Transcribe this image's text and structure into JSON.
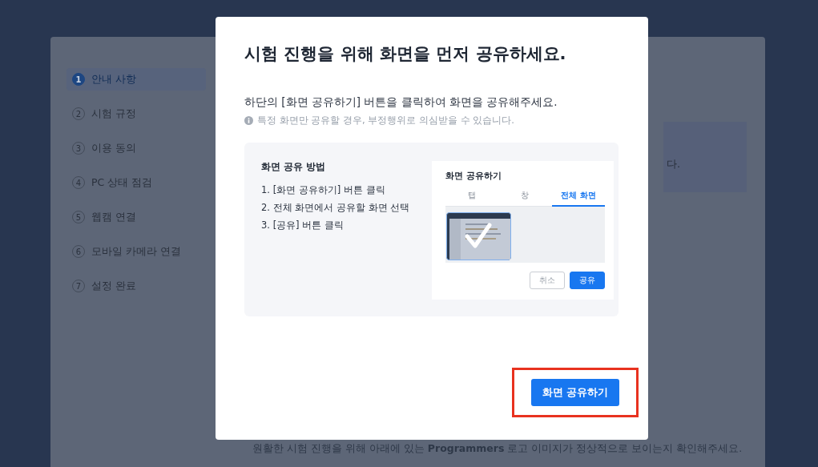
{
  "steps": [
    {
      "number": "1",
      "label": "안내 사항",
      "selected": true
    },
    {
      "number": "2",
      "label": "시험 규정",
      "selected": false
    },
    {
      "number": "3",
      "label": "이용 동의",
      "selected": false
    },
    {
      "number": "4",
      "label": "PC 상태 점검",
      "selected": false
    },
    {
      "number": "5",
      "label": "웹캠 연결",
      "selected": false
    },
    {
      "number": "6",
      "label": "모바일 카메라 연결",
      "selected": false
    },
    {
      "number": "7",
      "label": "설정 완료",
      "selected": false
    }
  ],
  "background_text": "다.",
  "bottom_note": "원활한 시험 진행을 위해 아래에 있는 **Programmers** 로고 이미지가 정상적으로 보이는지 확인해주세요.",
  "modal": {
    "title": "시험 진행을 위해 화면을 먼저 공유하세요.",
    "instruction": "하단의 [화면 공유하기] 버튼을 클릭하여 화면을 공유해주세요.",
    "notice": "특정 화면만 공유할 경우, 부정행위로 의심받을 수 있습니다.",
    "guide": {
      "heading": "화면 공유 방법",
      "steps": [
        "1. [화면 공유하기] 버튼 클릭",
        "2. 전체 화면에서 공유할 화면 선택",
        "3. [공유] 버튼 클릭"
      ],
      "example": {
        "title": "화면 공유하기",
        "tabs": [
          {
            "label": "탭",
            "selected": false
          },
          {
            "label": "창",
            "selected": false
          },
          {
            "label": "전체 화면",
            "selected": true
          }
        ],
        "thumbnail": {
          "selected": true
        },
        "buttons": [
          {
            "label": "취소",
            "kind": "secondary"
          },
          {
            "label": "공유",
            "kind": "primary"
          }
        ]
      }
    },
    "share_button": {
      "label": "화면 공유하기",
      "highlighted": true
    }
  }
}
